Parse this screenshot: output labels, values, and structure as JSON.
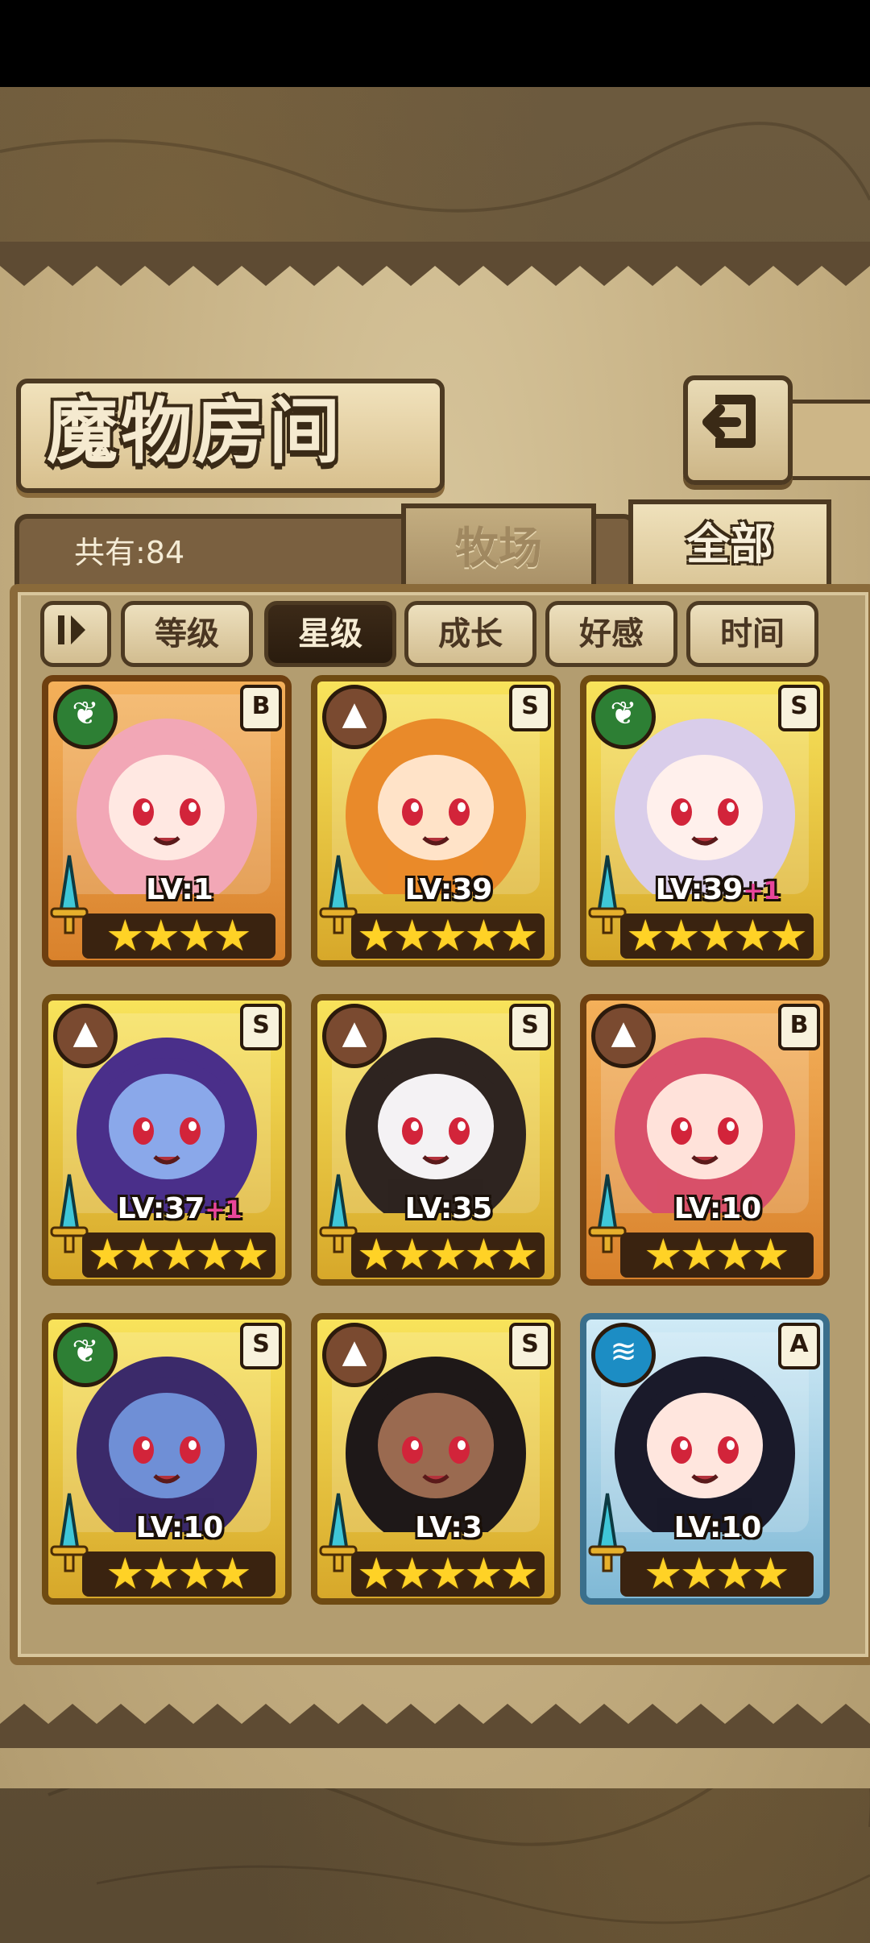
{
  "screen": {
    "title": "魔物房间",
    "total_count": "共有:84",
    "tabs": [
      {
        "label": "牧场",
        "active": false
      },
      {
        "label": "全部",
        "active": true
      }
    ],
    "filters": [
      {
        "label": "等级",
        "active": false
      },
      {
        "label": "星级",
        "active": true
      },
      {
        "label": "成长",
        "active": false
      },
      {
        "label": "好感",
        "active": false
      },
      {
        "label": "时间",
        "active": false
      }
    ],
    "icons": {
      "back": "return-arrow-icon",
      "sort": "sort-toggle-icon"
    }
  },
  "cards": [
    {
      "element": "leaf",
      "rank": "B",
      "level": "LV:1",
      "plus": "",
      "stars": 4,
      "frame": "orange",
      "hair": "#f2a7b6",
      "skin": "#ffe8e2"
    },
    {
      "element": "mountain",
      "rank": "S",
      "level": "LV:39",
      "plus": "",
      "stars": 5,
      "frame": "gold",
      "hair": "#e98a2a",
      "skin": "#ffe3c8"
    },
    {
      "element": "leaf",
      "rank": "S",
      "level": "LV:39",
      "plus": "+1",
      "stars": 5,
      "frame": "gold",
      "hair": "#d9cdea",
      "skin": "#fff0ec"
    },
    {
      "element": "mountain",
      "rank": "S",
      "level": "LV:37",
      "plus": "+1",
      "stars": 5,
      "frame": "gold",
      "hair": "#4a2f8a",
      "skin": "#8aa8ea"
    },
    {
      "element": "mountain",
      "rank": "S",
      "level": "LV:35",
      "plus": "",
      "stars": 5,
      "frame": "gold",
      "hair": "#2e2420",
      "skin": "#f4f2f4"
    },
    {
      "element": "mountain",
      "rank": "B",
      "level": "LV:10",
      "plus": "",
      "stars": 4,
      "frame": "orange",
      "hair": "#d8506a",
      "skin": "#ffe2da"
    },
    {
      "element": "leaf",
      "rank": "S",
      "level": "LV:10",
      "plus": "",
      "stars": 4,
      "frame": "gold",
      "hair": "#3b2a6a",
      "skin": "#6f8fd6"
    },
    {
      "element": "mountain",
      "rank": "S",
      "level": "LV:3",
      "plus": "",
      "stars": 5,
      "frame": "gold",
      "hair": "#1e1818",
      "skin": "#9a6a50"
    },
    {
      "element": "water",
      "rank": "A",
      "level": "LV:10",
      "plus": "",
      "stars": 4,
      "frame": "blue",
      "hair": "#1a1a2a",
      "skin": "#ffe6de"
    }
  ]
}
